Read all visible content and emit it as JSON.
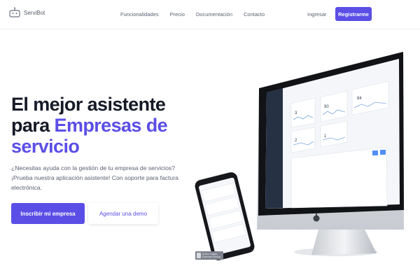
{
  "brand": {
    "name": "ServiBot",
    "primary": "#5b4ee6"
  },
  "nav": {
    "items": [
      "Funcionalidades",
      "Precio",
      "Documentación",
      "Contacto"
    ],
    "login": "Ingresar",
    "signup": "Registrarme"
  },
  "hero": {
    "title_line1": "El mejor asistente",
    "title_line2_plain": "para ",
    "title_line2_accent": "Empresas de",
    "title_line3_accent": "servicio",
    "subtitle": "¿Necesitas ayuda con la gestión de tu empresa de servicios? ¡Prueba nuestra aplicación asistente! Con soporte para factura electrónica.",
    "cta_primary": "Inscribir mi empresa",
    "cta_secondary": "Agendar una demo"
  },
  "mockup": {
    "stat_values": [
      "3",
      "90",
      "84",
      "2",
      "1"
    ],
    "badge_line1": "Deliver Images",
    "badge_line2": "Download Mockup"
  }
}
